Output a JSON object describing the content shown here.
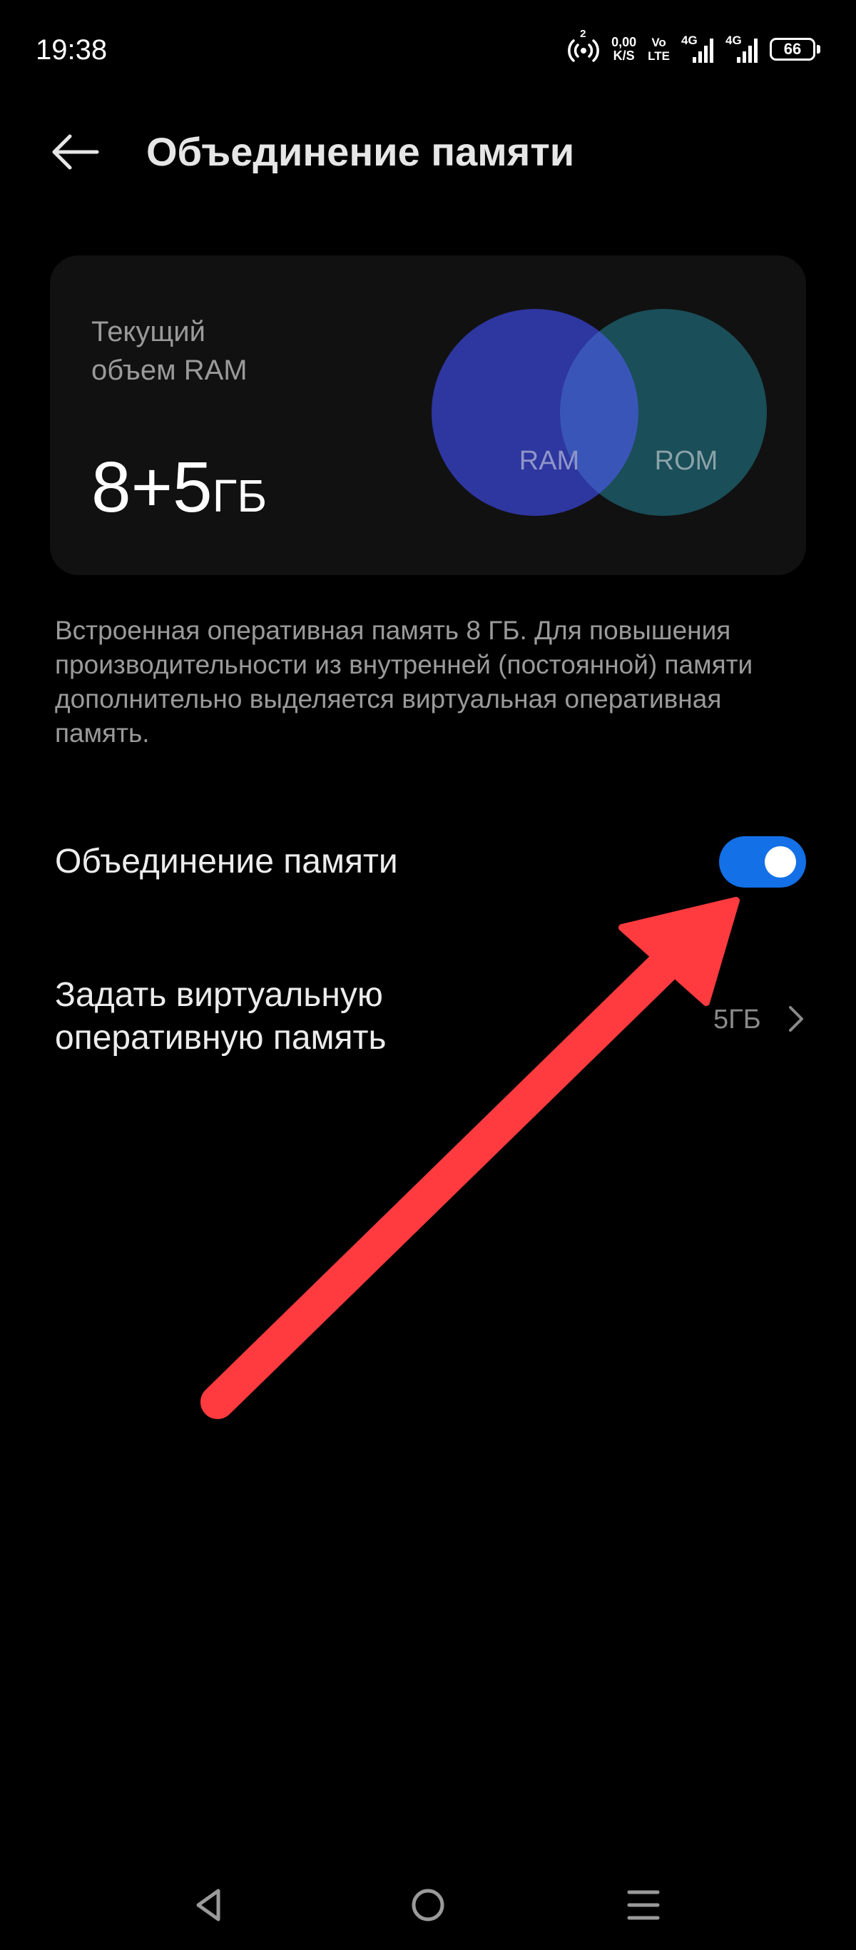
{
  "status_bar": {
    "time": "19:38",
    "hotspot_count": "2",
    "net_speed_value": "0,00",
    "net_speed_unit": "K/S",
    "volte_top": "Vo",
    "volte_bottom": "LTE",
    "sim1_label": "4G",
    "sim2_label": "4G",
    "battery": "66"
  },
  "header": {
    "title": "Объединение памяти"
  },
  "memory_card": {
    "label_line1": "Текущий",
    "label_line2": "объем RAM",
    "value": "8+5",
    "unit": "ГБ",
    "venn_left_label": "RAM",
    "venn_right_label": "ROM",
    "colors": {
      "ram": "#2e36a0",
      "rom": "#1a4e58",
      "overlap": "#3a55b8"
    }
  },
  "description": "Встроенная оперативная память 8 ГБ. Для повышения производительности из внутренней (постоянной) памяти дополнительно выделяется виртуальная оперативная память.",
  "settings": {
    "memory_merge": {
      "label": "Объединение памяти",
      "enabled": true
    },
    "virtual_memory": {
      "label_line1": "Задать виртуальную",
      "label_line2": "оперативную память",
      "value": "5ГБ"
    }
  },
  "annotation": {
    "arrow_color": "#ff3b3f"
  },
  "nav_bar": {
    "icons": [
      "triangle-back-icon",
      "circle-home-icon",
      "menu-lines-icon"
    ]
  }
}
